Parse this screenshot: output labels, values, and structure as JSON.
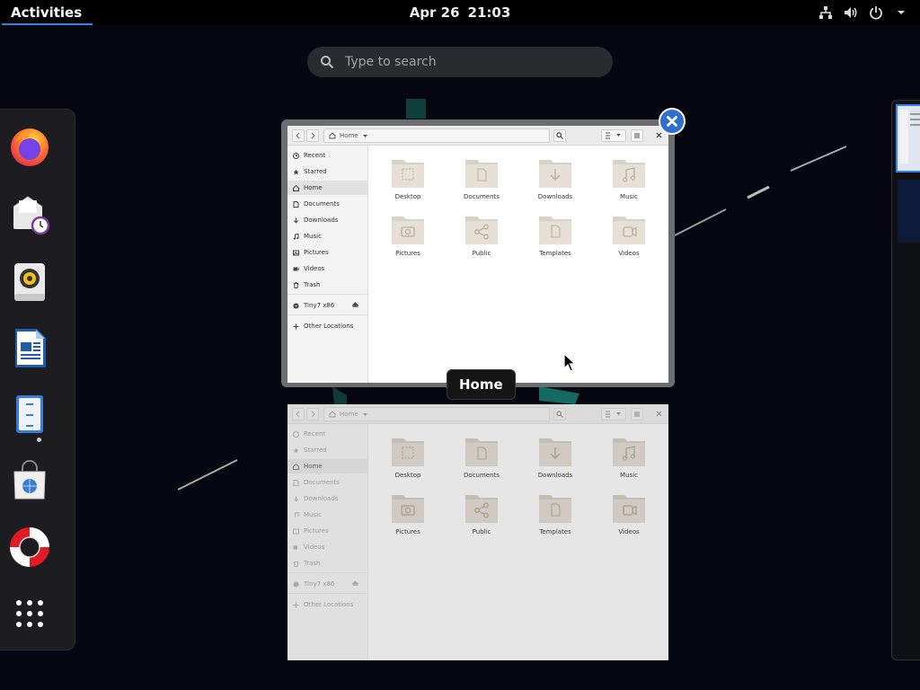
{
  "colors": {
    "accent": "#3584e4",
    "topbar": "#000000",
    "dash": "#1d1d21",
    "folder": "#e1dcd4"
  },
  "topbar": {
    "activities": "Activities",
    "date": "Apr 26",
    "time": "21:03",
    "tray_icons": [
      "network-icon",
      "volume-icon",
      "power-icon",
      "chevron-down-icon"
    ]
  },
  "search": {
    "placeholder": "Type to search"
  },
  "dash": {
    "apps": [
      {
        "name": "Firefox",
        "icon": "firefox-icon"
      },
      {
        "name": "Evolution",
        "icon": "mail-clock-icon"
      },
      {
        "name": "Rhythmbox",
        "icon": "speaker-icon"
      },
      {
        "name": "LibreOffice Writer",
        "icon": "document-icon"
      },
      {
        "name": "Files",
        "icon": "file-cabinet-icon",
        "running": true
      },
      {
        "name": "Software",
        "icon": "shopping-bag-icon"
      },
      {
        "name": "Help",
        "icon": "lifebuoy-icon"
      },
      {
        "name": "Show Applications",
        "icon": "app-grid-icon"
      }
    ]
  },
  "window": {
    "tooltip": "Home",
    "path": "Home",
    "sidebar": [
      {
        "label": "Recent",
        "icon": "clock-icon"
      },
      {
        "label": "Starred",
        "icon": "star-icon"
      },
      {
        "label": "Home",
        "icon": "home-icon",
        "selected": true
      },
      {
        "label": "Documents",
        "icon": "document-icon"
      },
      {
        "label": "Downloads",
        "icon": "download-icon"
      },
      {
        "label": "Music",
        "icon": "music-icon"
      },
      {
        "label": "Pictures",
        "icon": "picture-icon"
      },
      {
        "label": "Videos",
        "icon": "video-icon"
      },
      {
        "label": "Trash",
        "icon": "trash-icon"
      },
      {
        "label": "Tiny7 x86",
        "icon": "disc-icon",
        "eject": true
      },
      {
        "label": "Other Locations",
        "icon": "plus-icon"
      }
    ],
    "folders": [
      {
        "label": "Desktop",
        "icon": "desktop-folder-icon"
      },
      {
        "label": "Documents",
        "icon": "documents-folder-icon"
      },
      {
        "label": "Downloads",
        "icon": "downloads-folder-icon"
      },
      {
        "label": "Music",
        "icon": "music-folder-icon"
      },
      {
        "label": "Pictures",
        "icon": "pictures-folder-icon"
      },
      {
        "label": "Public",
        "icon": "public-folder-icon"
      },
      {
        "label": "Templates",
        "icon": "templates-folder-icon"
      },
      {
        "label": "Videos",
        "icon": "videos-folder-icon"
      }
    ]
  }
}
